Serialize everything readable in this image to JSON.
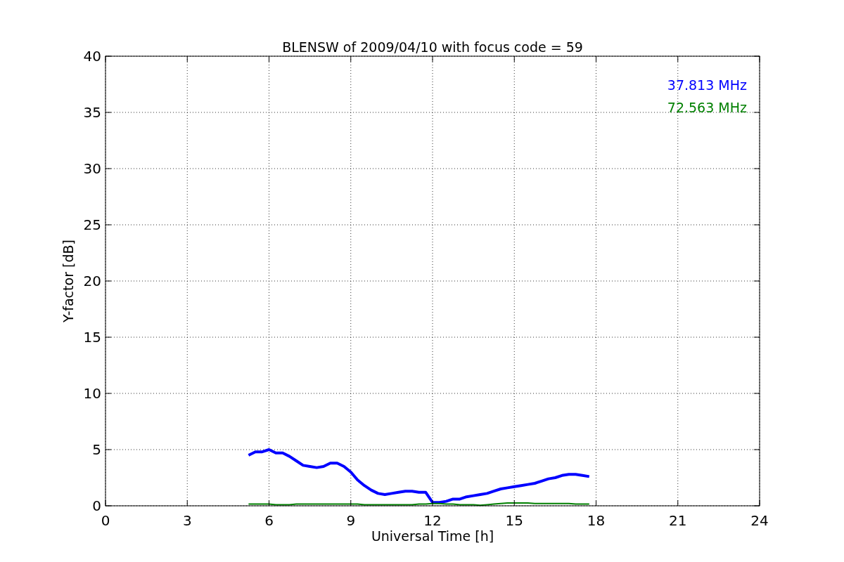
{
  "chart_data": {
    "type": "line",
    "title": "BLENSW of 2009/04/10 with focus code = 59",
    "xlabel": "Universal Time [h]",
    "ylabel": "Y-factor [dB]",
    "x": [
      5.25,
      5.5,
      5.75,
      6,
      6.25,
      6.5,
      6.75,
      7,
      7.25,
      7.5,
      7.75,
      8,
      8.25,
      8.5,
      8.75,
      9,
      9.25,
      9.5,
      9.75,
      10,
      10.25,
      10.5,
      10.75,
      11,
      11.25,
      11.5,
      11.75,
      12,
      12.25,
      12.5,
      12.75,
      13,
      13.25,
      13.5,
      13.75,
      14,
      14.25,
      14.5,
      14.75,
      15,
      15.25,
      15.5,
      15.75,
      16,
      16.25,
      16.5,
      16.75,
      17,
      17.25,
      17.5,
      17.75
    ],
    "series": [
      {
        "name": "37.813 MHz",
        "color": "#0000ff",
        "values": [
          4.5,
          4.8,
          4.8,
          5.0,
          4.7,
          4.7,
          4.4,
          4.0,
          3.6,
          3.5,
          3.4,
          3.5,
          3.8,
          3.8,
          3.5,
          3.0,
          2.3,
          1.8,
          1.4,
          1.1,
          1.0,
          1.1,
          1.2,
          1.3,
          1.3,
          1.2,
          1.2,
          0.3,
          0.3,
          0.4,
          0.6,
          0.6,
          0.8,
          0.9,
          1.0,
          1.1,
          1.3,
          1.5,
          1.6,
          1.7,
          1.8,
          1.9,
          2.0,
          2.2,
          2.4,
          2.5,
          2.7,
          2.8,
          2.8,
          2.7,
          2.6
        ]
      },
      {
        "name": "72.563 MHz",
        "color": "#008000",
        "values": [
          0.15,
          0.15,
          0.15,
          0.15,
          0.1,
          0.1,
          0.1,
          0.15,
          0.15,
          0.15,
          0.15,
          0.15,
          0.15,
          0.15,
          0.15,
          0.15,
          0.15,
          0.1,
          0.1,
          0.1,
          0.1,
          0.1,
          0.1,
          0.1,
          0.1,
          0.15,
          0.15,
          0.2,
          0.2,
          0.15,
          0.15,
          0.1,
          0.1,
          0.1,
          0.05,
          0.1,
          0.15,
          0.2,
          0.25,
          0.25,
          0.25,
          0.25,
          0.2,
          0.2,
          0.2,
          0.2,
          0.2,
          0.2,
          0.15,
          0.15,
          0.15
        ]
      }
    ],
    "xlim": [
      0,
      24
    ],
    "ylim": [
      0,
      40
    ],
    "xticks": [
      0,
      3,
      6,
      9,
      12,
      15,
      18,
      21,
      24
    ],
    "yticks": [
      0,
      5,
      10,
      15,
      20,
      25,
      30,
      35,
      40
    ],
    "grid": true
  }
}
